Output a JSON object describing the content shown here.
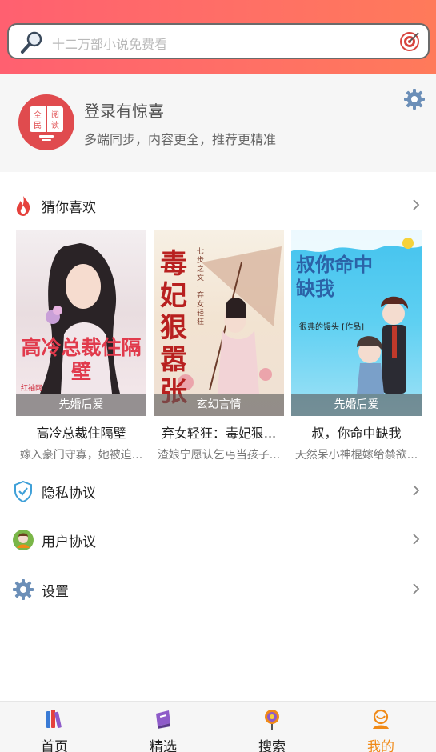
{
  "search": {
    "placeholder": "十二万部小说免费看"
  },
  "login": {
    "avatar_text": [
      "全",
      "阅",
      "民",
      "读"
    ],
    "title": "登录有惊喜",
    "subtitle": "多端同步，内容更全，推荐更精准"
  },
  "recommend": {
    "title": "猜你喜欢",
    "books": [
      {
        "tag": "先婚后爱",
        "title": "高冷总裁住隔壁",
        "desc": "嫁入豪门守寡，她被迫...",
        "cover_text": "高冷总裁住隔壁",
        "cover_small": "红袖网"
      },
      {
        "tag": "玄幻言情",
        "title": "弃女轻狂：毒妃狠...",
        "desc": "渣娘宁愿认乞丐当孩子...",
        "cover_text": "毒妃狠嚣张",
        "cover_small": "七步之文 · 弃女轻狂"
      },
      {
        "tag": "先婚后爱",
        "title": "叔，你命中缺我",
        "desc": "天然呆小神棍嫁给禁欲...",
        "cover_text": "叔你命中缺我",
        "cover_small": "很弗的馒头 [作品]"
      }
    ]
  },
  "menu": [
    {
      "label": "隐私协议",
      "icon": "shield-check-icon"
    },
    {
      "label": "用户协议",
      "icon": "user-avatar-icon"
    },
    {
      "label": "设置",
      "icon": "gear-icon"
    }
  ],
  "tabs": [
    {
      "label": "首页",
      "icon": "books-icon"
    },
    {
      "label": "精选",
      "icon": "book-stack-icon"
    },
    {
      "label": "搜索",
      "icon": "lollipop-icon"
    },
    {
      "label": "我的",
      "icon": "person-icon",
      "active": true
    }
  ],
  "colors": {
    "header": "#ff6570",
    "accent": "#f08a18",
    "avatar": "#e04b4e",
    "icon_blue": "#6c8fb8"
  }
}
